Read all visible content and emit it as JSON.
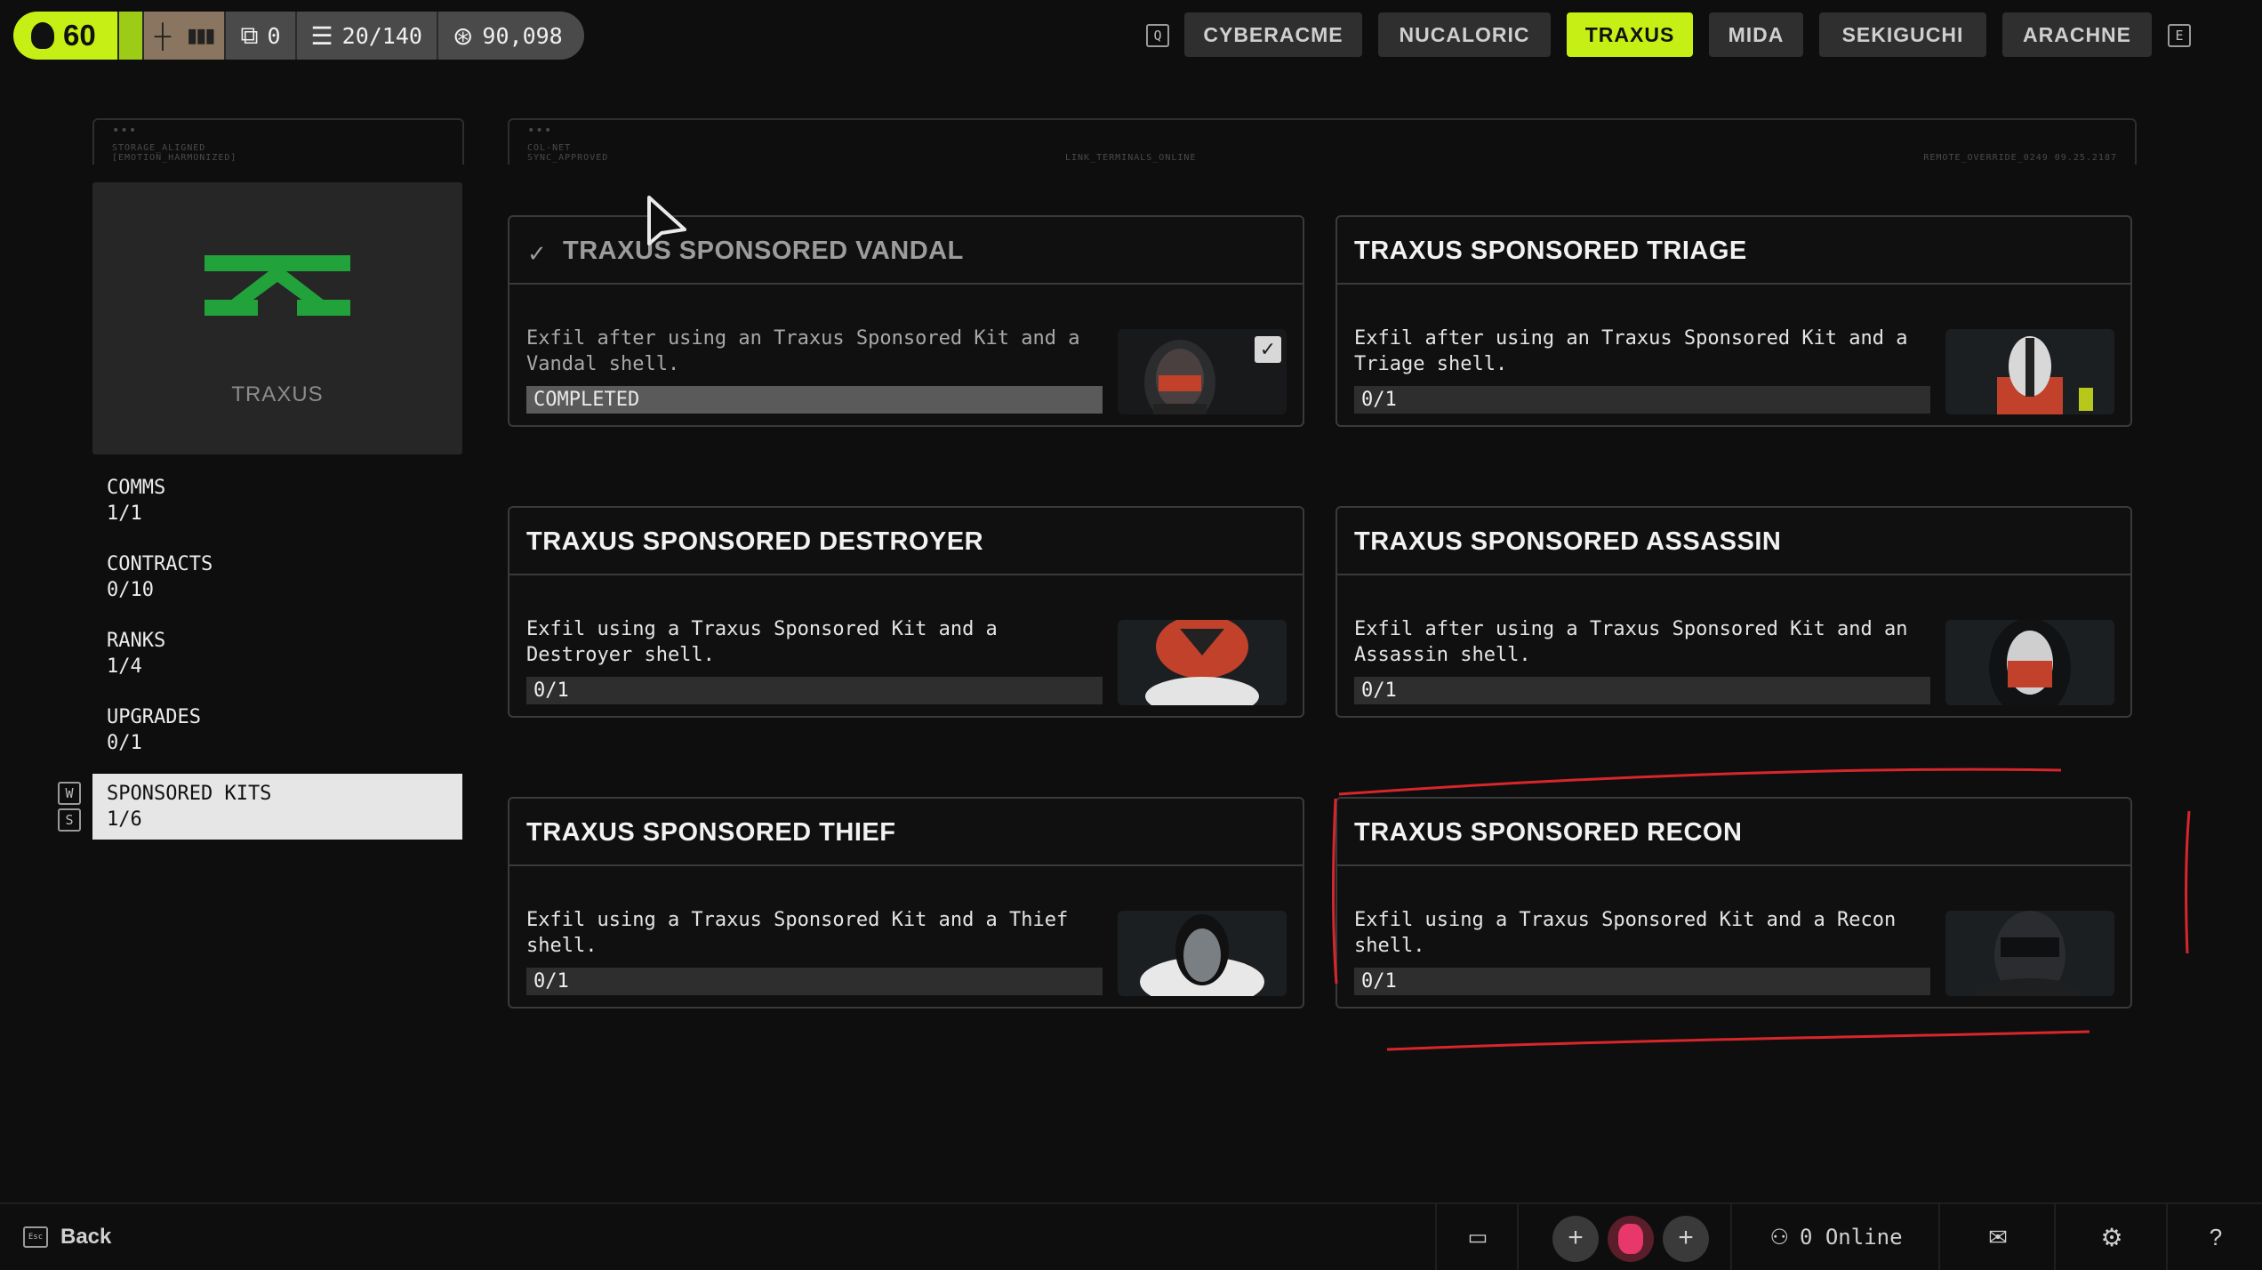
{
  "topbar": {
    "level": "60",
    "storage": "0",
    "capacity": "20/140",
    "credits": "90,098"
  },
  "factions": {
    "left_key": "Q",
    "right_key": "E",
    "tabs": [
      {
        "label": "CYBERACME",
        "active": false
      },
      {
        "label": "NUCALORIC",
        "active": false
      },
      {
        "label": "TRAXUS",
        "active": true
      },
      {
        "label": "MIDA",
        "active": false
      },
      {
        "label": "SEKIGUCHI",
        "active": false
      },
      {
        "label": "ARACHNE",
        "active": false
      }
    ]
  },
  "deco": {
    "left_1": "STORAGE_ALIGNED",
    "left_2": "[EMOTION_HARMONIZED]",
    "right_1": "COL-NET",
    "right_2": "SYNC_APPROVED",
    "right_mid": "LINK_TERMINALS_ONLINE",
    "right_end": "REMOTE_OVERRIDE_0249 09.25.2187"
  },
  "faction_panel": {
    "name": "TRAXUS",
    "logo_color": "#22a23a"
  },
  "sidebar": {
    "nav_key_up": "W",
    "nav_key_down": "S",
    "items": [
      {
        "label": "COMMS",
        "count": "1/1"
      },
      {
        "label": "CONTRACTS",
        "count": "0/10"
      },
      {
        "label": "RANKS",
        "count": "1/4"
      },
      {
        "label": "UPGRADES",
        "count": "0/1"
      },
      {
        "label": "SPONSORED KITS",
        "count": "1/6"
      }
    ]
  },
  "cards": [
    {
      "title": "TRAXUS SPONSORED VANDAL",
      "desc": "Exfil after using an Traxus Sponsored Kit and a Vandal shell.",
      "progress": "COMPLETED",
      "completed": true,
      "progress_fraction": 1
    },
    {
      "title": "TRAXUS SPONSORED TRIAGE",
      "desc": "Exfil after using an Traxus Sponsored Kit and a Triage shell.",
      "progress": "0/1",
      "completed": false,
      "progress_fraction": 0
    },
    {
      "title": "TRAXUS SPONSORED DESTROYER",
      "desc": "Exfil using a Traxus Sponsored Kit and a Destroyer shell.",
      "progress": "0/1",
      "completed": false,
      "progress_fraction": 0
    },
    {
      "title": "TRAXUS SPONSORED ASSASSIN",
      "desc": "Exfil after using a Traxus Sponsored Kit and an Assassin shell.",
      "progress": "0/1",
      "completed": false,
      "progress_fraction": 0
    },
    {
      "title": "TRAXUS SPONSORED THIEF",
      "desc": "Exfil using a Traxus Sponsored Kit and a Thief shell.",
      "progress": "0/1",
      "completed": false,
      "progress_fraction": 0
    },
    {
      "title": "TRAXUS SPONSORED RECON",
      "desc": "Exfil using a Traxus Sponsored Kit and a Recon shell.",
      "progress": "0/1",
      "completed": false,
      "progress_fraction": 0
    }
  ],
  "bottombar": {
    "back_key": "Esc",
    "back_label": "Back",
    "online": "0 Online"
  },
  "colors": {
    "accent": "#c6f015",
    "annotation": "#d8262b"
  }
}
